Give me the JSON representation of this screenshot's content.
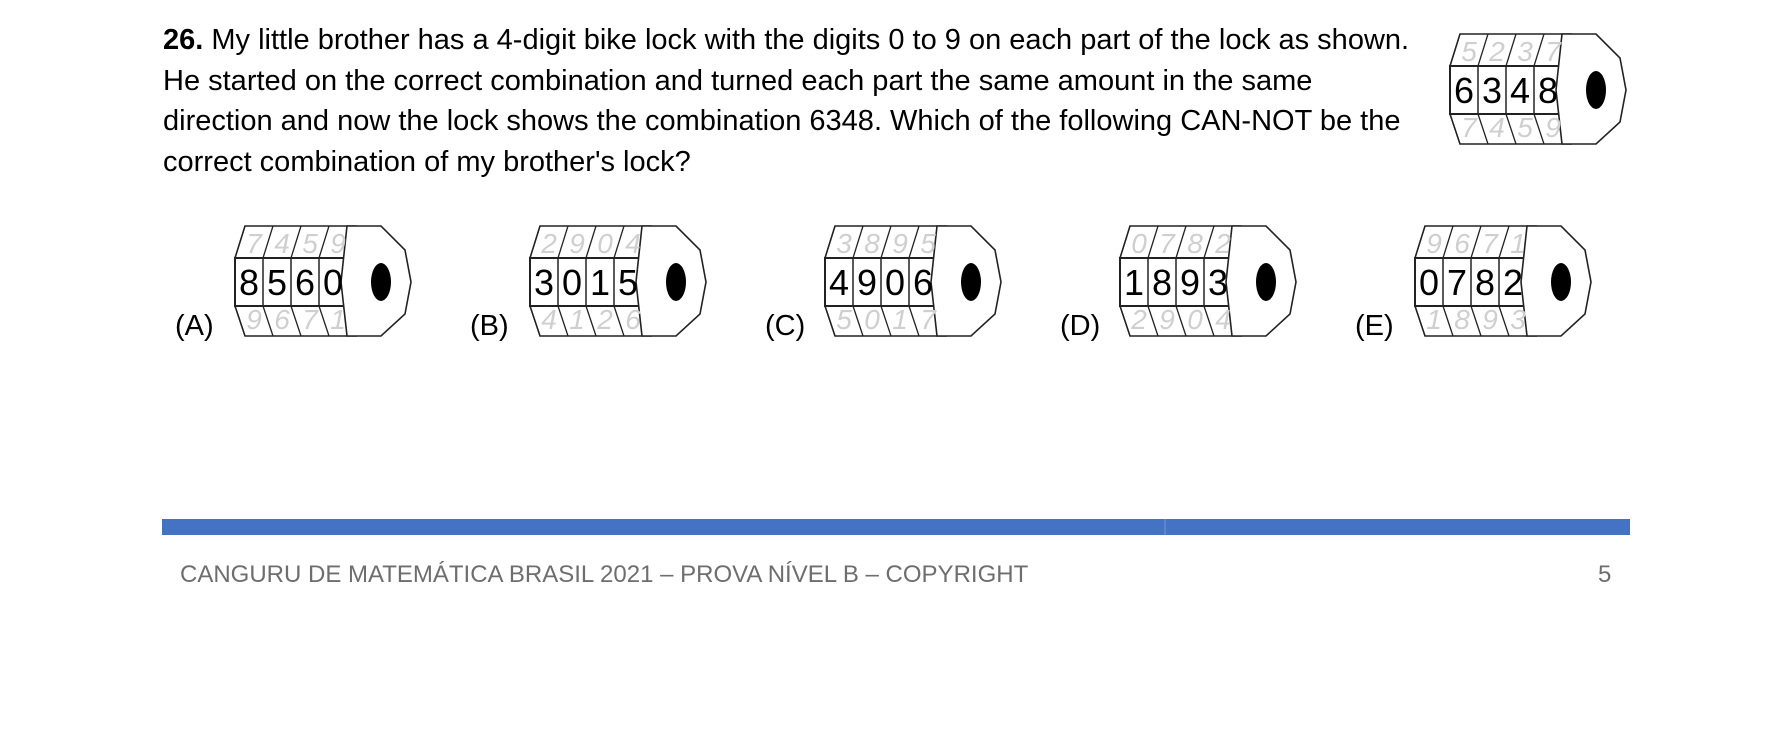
{
  "question": {
    "number": "26.",
    "text": "My little brother has a 4-digit bike lock with the digits 0 to 9 on each part of the lock as shown. He started on the correct combination and turned each part the same amount in the same direction and now the lock shows the combination 6348. Which of the following CAN-NOT be the correct combination of my brother's lock?"
  },
  "main_lock": {
    "top": [
      "5",
      "2",
      "3",
      "7"
    ],
    "mid": [
      "6",
      "3",
      "4",
      "8"
    ],
    "bot": [
      "7",
      "4",
      "5",
      "9"
    ]
  },
  "options": [
    {
      "label": "(A)",
      "top": [
        "7",
        "4",
        "5",
        "9"
      ],
      "mid": [
        "8",
        "5",
        "6",
        "0"
      ],
      "bot": [
        "9",
        "6",
        "7",
        "1"
      ]
    },
    {
      "label": "(B)",
      "top": [
        "2",
        "9",
        "0",
        "4"
      ],
      "mid": [
        "3",
        "0",
        "1",
        "5"
      ],
      "bot": [
        "4",
        "1",
        "2",
        "6"
      ]
    },
    {
      "label": "(C)",
      "top": [
        "3",
        "8",
        "9",
        "5"
      ],
      "mid": [
        "4",
        "9",
        "0",
        "6"
      ],
      "bot": [
        "5",
        "0",
        "1",
        "7"
      ]
    },
    {
      "label": "(D)",
      "top": [
        "0",
        "7",
        "8",
        "2"
      ],
      "mid": [
        "1",
        "8",
        "9",
        "3"
      ],
      "bot": [
        "2",
        "9",
        "0",
        "4"
      ]
    },
    {
      "label": "(E)",
      "top": [
        "9",
        "6",
        "7",
        "1"
      ],
      "mid": [
        "0",
        "7",
        "8",
        "2"
      ],
      "bot": [
        "1",
        "8",
        "9",
        "3"
      ]
    }
  ],
  "footer": {
    "text": "CANGURU DE MATEMÁTICA BRASIL 2021 – PROVA NÍVEL B – COPYRIGHT",
    "page": "5",
    "rule_color": "#4472c4"
  }
}
